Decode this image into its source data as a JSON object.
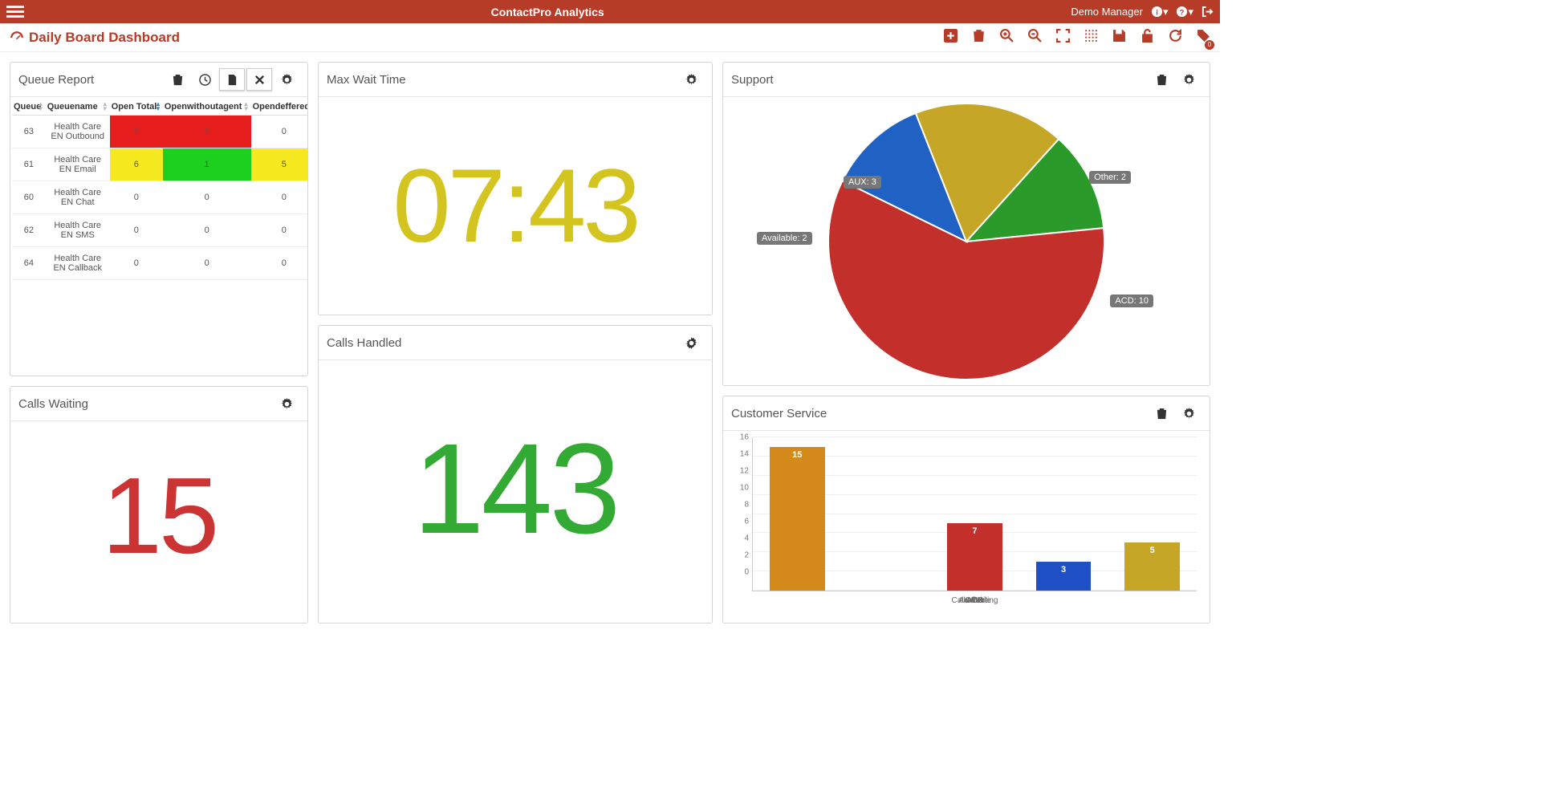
{
  "app_title": "ContactPro Analytics",
  "user_name": "Demo Manager",
  "page_title": "Daily Board Dashboard",
  "toolbar_badge": "0",
  "widgets": {
    "queue": {
      "title": "Queue Report",
      "columns": [
        "Queue",
        "Queuename",
        "Open Total",
        "Openwithoutagent",
        "Opendeffered"
      ],
      "rows": [
        {
          "c0": "63",
          "c1": "Health Care EN Outbound",
          "c2": "7",
          "c3": "7",
          "c4": "0",
          "c2bg": "bg-red",
          "c3bg": "bg-red"
        },
        {
          "c0": "61",
          "c1": "Health Care EN Email",
          "c2": "6",
          "c3": "1",
          "c4": "5",
          "c2bg": "bg-yellow",
          "c3bg": "bg-green",
          "c4bg": "bg-yellow"
        },
        {
          "c0": "60",
          "c1": "Health Care EN Chat",
          "c2": "0",
          "c3": "0",
          "c4": "0"
        },
        {
          "c0": "62",
          "c1": "Health Care EN SMS",
          "c2": "0",
          "c3": "0",
          "c4": "0"
        },
        {
          "c0": "64",
          "c1": "Health Care EN Callback",
          "c2": "0",
          "c3": "0",
          "c4": "0"
        }
      ]
    },
    "maxwait": {
      "title": "Max Wait Time",
      "value": "07:43"
    },
    "callshandled": {
      "title": "Calls Handled",
      "value": "143"
    },
    "callswaiting": {
      "title": "Calls Waiting",
      "value": "15"
    },
    "support": {
      "title": "Support"
    },
    "custsvc": {
      "title": "Customer Service"
    }
  },
  "chart_data": [
    {
      "id": "support_pie",
      "type": "pie",
      "title": "Support",
      "series": [
        {
          "name": "ACD",
          "value": 10,
          "color": "#c32f2a"
        },
        {
          "name": "AUX",
          "value": 3,
          "color": "#c6a627"
        },
        {
          "name": "Available",
          "value": 2,
          "color": "#2a9b2a"
        },
        {
          "name": "Other",
          "value": 2,
          "color": "#1f62c4"
        }
      ],
      "labels": [
        "ACD: 10",
        "AUX: 3",
        "Available: 2",
        "Other: 2"
      ]
    },
    {
      "id": "custsvc_bar",
      "type": "bar",
      "title": "Customer Service",
      "categories": [
        "Calls Waiting",
        "Available",
        "ACD",
        "Other",
        "AUX"
      ],
      "values": [
        15,
        0,
        7,
        3,
        5
      ],
      "colors": [
        "#d48a1a",
        "#2a9b2a",
        "#c32f2a",
        "#1f4fc4",
        "#c6a627"
      ],
      "ylim": [
        0,
        16
      ],
      "yticks": [
        0,
        2,
        4,
        6,
        8,
        10,
        12,
        14,
        16
      ]
    }
  ]
}
